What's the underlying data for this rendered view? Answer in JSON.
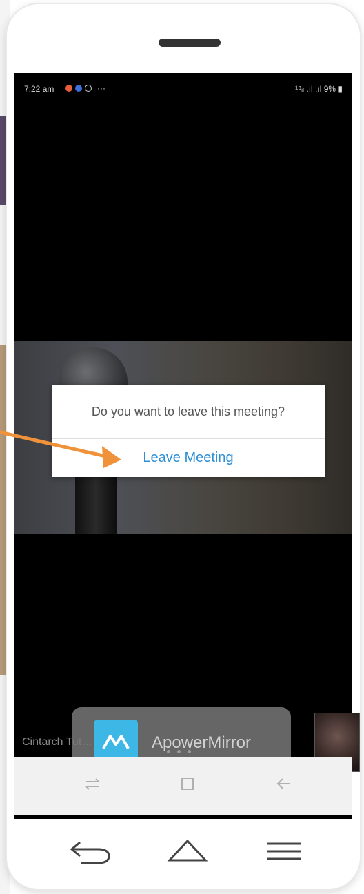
{
  "status_bar": {
    "time": "7:22 am",
    "overflow": "···",
    "right": "¹⁸ᵢₗ .ıl .ıl 9% ▮"
  },
  "dialog": {
    "message": "Do you want to leave this meeting?",
    "leave_button": "Leave Meeting"
  },
  "video": {
    "participant_name": "Cintarch Tut…"
  },
  "overlay": {
    "app_name": "ApowerMirror"
  },
  "colors": {
    "accent": "#2d8fd5",
    "arrow": "#f0923a",
    "apower_logo": "#3db7e6"
  },
  "icons": {
    "system_nav": [
      "recents-icon",
      "home-square-icon",
      "back-arrow-icon"
    ],
    "hardware_nav": [
      "back-curved-icon",
      "home-outline-icon",
      "menu-lines-icon"
    ]
  }
}
